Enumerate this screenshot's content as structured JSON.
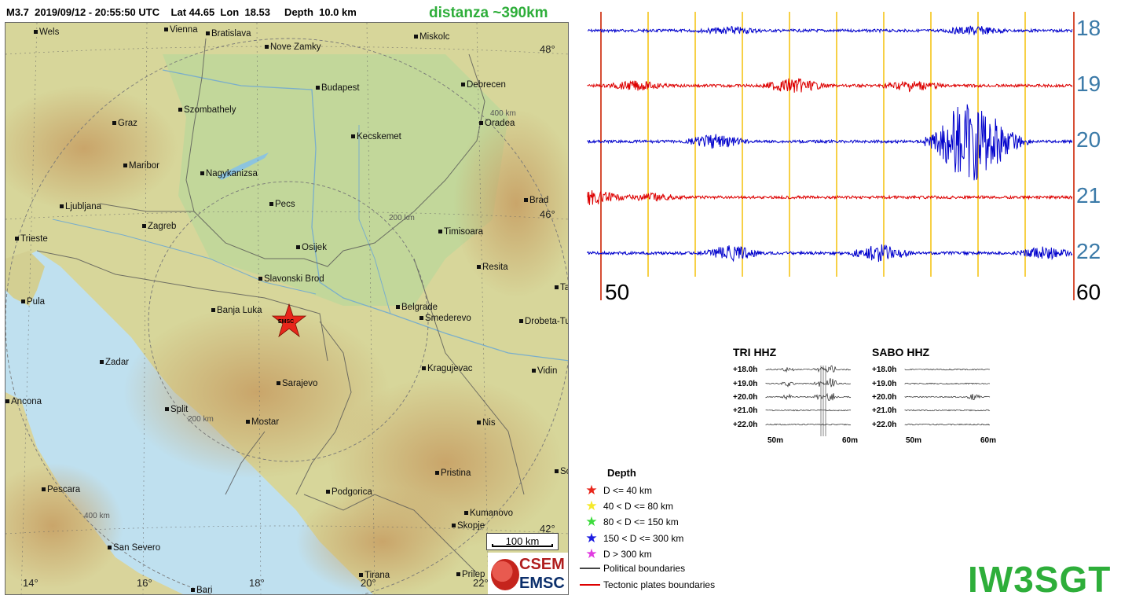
{
  "header": {
    "meta": "M3.7  2019/09/12 - 20:55:50 UTC    Lat 44.65  Lon  18.53     Depth  10.0 km",
    "distance": "distanza ~390km"
  },
  "map": {
    "cities": [
      {
        "name": "Wels"
      },
      {
        "name": "Vienna"
      },
      {
        "name": "Bratislava"
      },
      {
        "name": "Nove Zamky"
      },
      {
        "name": "Miskolc"
      },
      {
        "name": "Debrecen"
      },
      {
        "name": "Budapest"
      },
      {
        "name": "Szombathely"
      },
      {
        "name": "Graz"
      },
      {
        "name": "Oradea"
      },
      {
        "name": "Kecskemet"
      },
      {
        "name": "Maribor"
      },
      {
        "name": "Nagykanizsa"
      },
      {
        "name": "Brad"
      },
      {
        "name": "Ljubljana"
      },
      {
        "name": "Pecs"
      },
      {
        "name": "Zagreb"
      },
      {
        "name": "Timisoara"
      },
      {
        "name": "Trieste"
      },
      {
        "name": "Osijek"
      },
      {
        "name": "Resita"
      },
      {
        "name": "Slavonski Brod"
      },
      {
        "name": "Pula"
      },
      {
        "name": "Banja Luka"
      },
      {
        "name": "Belgrade"
      },
      {
        "name": "Smederevo"
      },
      {
        "name": "Drobeta-Tu"
      },
      {
        "name": "Zadar"
      },
      {
        "name": "Kragujevac"
      },
      {
        "name": "Vidin"
      },
      {
        "name": "Sarajevo"
      },
      {
        "name": "Ancona"
      },
      {
        "name": "Split"
      },
      {
        "name": "Mostar"
      },
      {
        "name": "Nis"
      },
      {
        "name": "Pristina"
      },
      {
        "name": "Pescara"
      },
      {
        "name": "Podgorica"
      },
      {
        "name": "Kumanovo"
      },
      {
        "name": "Skopje"
      },
      {
        "name": "San Severo"
      },
      {
        "name": "Tirana"
      },
      {
        "name": "Prilep"
      },
      {
        "name": "Bari"
      },
      {
        "name": "Ta"
      },
      {
        "name": "So"
      }
    ],
    "lat_labels": [
      "48°",
      "46°",
      "42°"
    ],
    "lon_labels": [
      "14°",
      "16°",
      "18°",
      "20°",
      "22°"
    ],
    "ring_labels": [
      "400 km",
      "200 km",
      "200 km",
      "400 km"
    ],
    "epicenter_label": "EMSC",
    "scale_label": "100 km",
    "logo_top": "CSEM",
    "logo_bottom": "EMSC"
  },
  "helicorder": {
    "hours": [
      "18",
      "19",
      "20",
      "21",
      "22"
    ],
    "start_minute": "50",
    "end_minute": "60",
    "trace_colors": [
      "#0000cc",
      "#dd0000",
      "#0000cc",
      "#dd0000",
      "#0000cc"
    ],
    "gridline_color": "#f5c518",
    "boundary_color": "#cc2200"
  },
  "stations": [
    {
      "title": "TRI HHZ",
      "hours": [
        "+18.0h",
        "+19.0h",
        "+20.0h",
        "+21.0h",
        "+22.0h"
      ],
      "axis": [
        "50m",
        "60m"
      ]
    },
    {
      "title": "SABO HHZ",
      "hours": [
        "+18.0h",
        "+19.0h",
        "+20.0h",
        "+21.0h",
        "+22.0h"
      ],
      "axis": [
        "50m",
        "60m"
      ]
    }
  ],
  "legend": {
    "title": "Depth",
    "items": [
      {
        "label": "D <= 40 km",
        "color": "#e8261b",
        "kind": "star"
      },
      {
        "label": "40 < D <= 80 km",
        "color": "#f5e92a",
        "kind": "star"
      },
      {
        "label": "80 < D <= 150 km",
        "color": "#3ddc3d",
        "kind": "star"
      },
      {
        "label": "150 < D <= 300 km",
        "color": "#1c1ce0",
        "kind": "star"
      },
      {
        "label": "D > 300 km",
        "color": "#e03ce0",
        "kind": "star"
      },
      {
        "label": "Political boundaries",
        "color": "#444444",
        "kind": "line"
      },
      {
        "label": "Tectonic plates boundaries",
        "color": "#dd0000",
        "kind": "line"
      }
    ]
  },
  "callsign": "IW3SGT"
}
